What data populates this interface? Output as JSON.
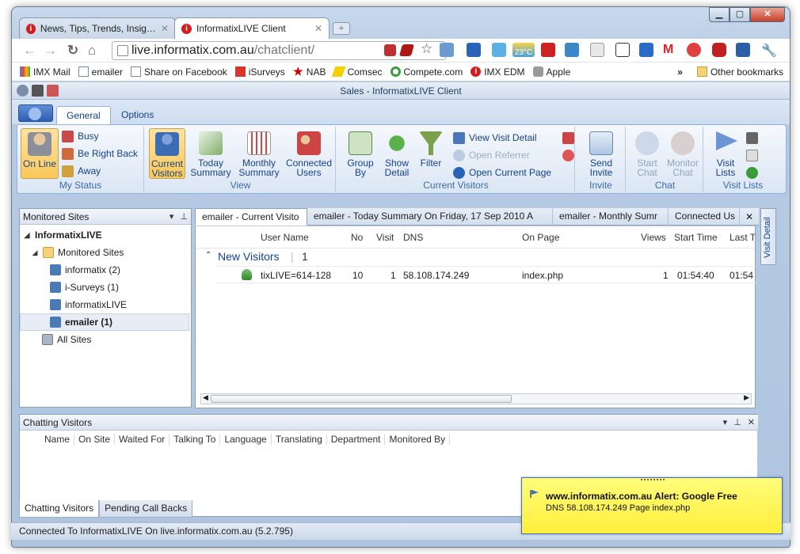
{
  "browser": {
    "tabs": [
      {
        "label": "News, Tips, Trends, Insig…"
      },
      {
        "label": "InformatixLIVE Client"
      }
    ],
    "url": {
      "host": "live.informatix.com.au",
      "path": "/chatclient/"
    },
    "weather": "23°C",
    "bookmarks": [
      {
        "label": "IMX Mail"
      },
      {
        "label": "emailer"
      },
      {
        "label": "Share on Facebook"
      },
      {
        "label": "iSurveys"
      },
      {
        "label": "NAB"
      },
      {
        "label": "Comsec"
      },
      {
        "label": "Compete.com"
      },
      {
        "label": "IMX EDM"
      },
      {
        "label": "Apple"
      }
    ],
    "other_bookmarks": "Other bookmarks"
  },
  "app": {
    "title": "Sales - InformatixLIVE Client",
    "ribbon_tabs": [
      "General",
      "Options"
    ],
    "groups": {
      "my_status": {
        "label": "My Status",
        "online": "On Line",
        "busy": "Busy",
        "brb": "Be Right Back",
        "away": "Away"
      },
      "view": {
        "label": "View",
        "current": "Current Visitors",
        "today": "Today Summary",
        "monthly": "Monthly Summary",
        "connected": "Connected Users"
      },
      "current_visitors": {
        "label": "Current Visitors",
        "group_by": "Group By",
        "show_detail": "Show Detail",
        "filter": "Filter",
        "view_visit_detail": "View Visit Detail",
        "open_referrer": "Open Referrer",
        "open_current_page": "Open Current Page"
      },
      "invite": {
        "label": "Invite",
        "send_invite": "Send Invite"
      },
      "chat": {
        "label": "Chat",
        "start_chat": "Start Chat",
        "monitor_chat": "Monitor Chat"
      },
      "visit_lists": {
        "label": "Visit Lists",
        "visit_lists": "Visit Lists"
      }
    }
  },
  "monitored": {
    "title": "Monitored Sites",
    "root": "InformatixLIVE",
    "folder": "Monitored Sites",
    "sites": [
      "informatix (2)",
      "i-Surveys (1)",
      "informatixLIVE",
      "emailer (1)"
    ],
    "all": "All Sites"
  },
  "doc_tabs": [
    "emailer - Current Visito",
    "emailer - Today Summary On Friday, 17 Sep 2010 A",
    "emailer - Monthly Sumr",
    "Connected Us"
  ],
  "grid": {
    "columns": [
      "User Name",
      "No",
      "Visit",
      "DNS",
      "On Page",
      "Views",
      "Start Time",
      "Last T"
    ],
    "group": {
      "label": "New Visitors",
      "count": "1"
    },
    "rows": [
      {
        "user": "tixLIVE=614-128",
        "no": "10",
        "visit": "1",
        "dns": "58.108.174.249",
        "page": "index.php",
        "views": "1",
        "start": "01:54:40",
        "last": "01:54"
      }
    ]
  },
  "visit_detail": "Visit Detail",
  "chatting": {
    "title": "Chatting Visitors",
    "columns": [
      "Name",
      "On Site",
      "Waited For",
      "Talking To",
      "Language",
      "Translating",
      "Department",
      "Monitored By"
    ],
    "tabs": [
      "Chatting Visitors",
      "Pending Call Backs"
    ]
  },
  "status": "Connected To InformatixLIVE On live.informatix.com.au (5.2.795)",
  "alert": {
    "title": "www.informatix.com.au Alert: Google Free",
    "body": "DNS 58.108.174.249 Page index.php"
  }
}
